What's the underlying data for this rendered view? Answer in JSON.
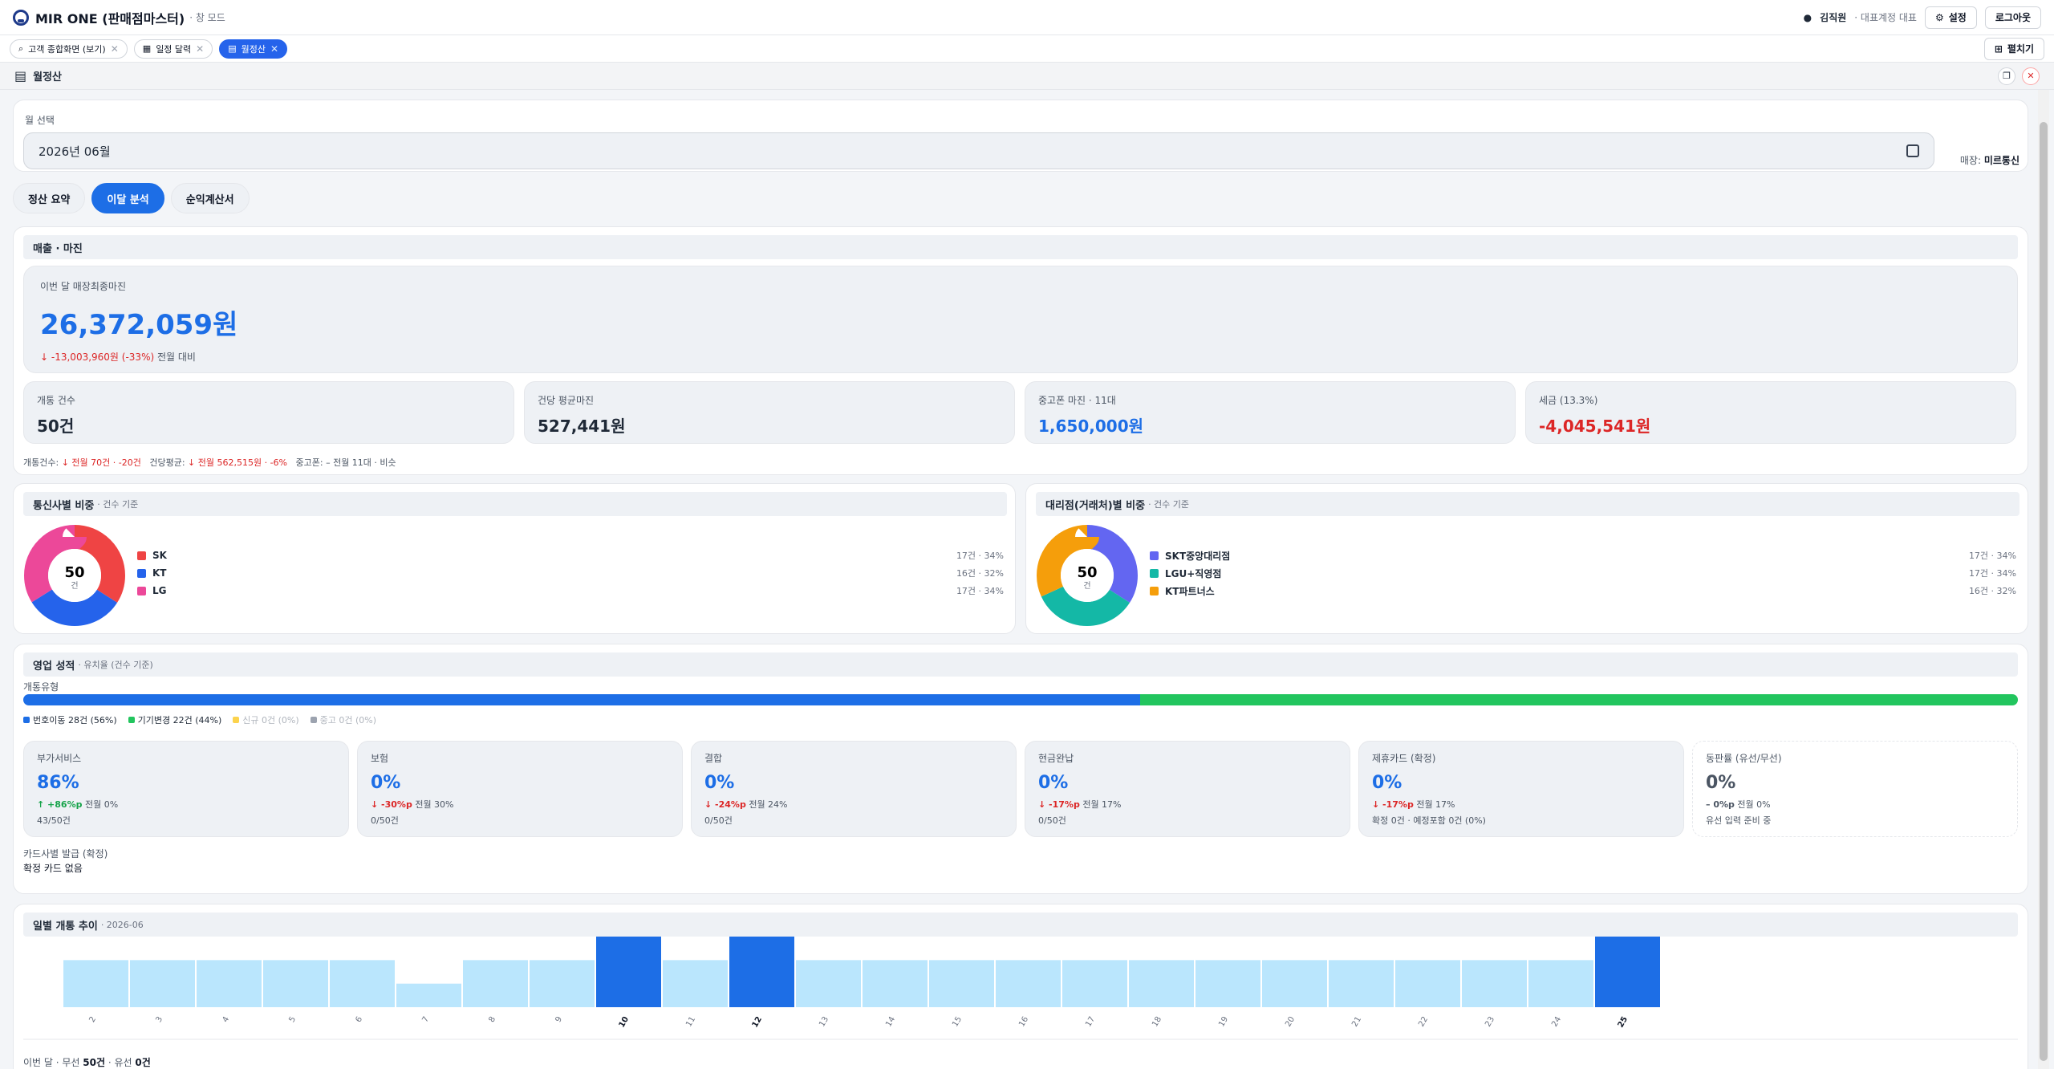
{
  "app": {
    "title": "MIR ONE (판매점마스터)",
    "mode": "· 창 모드"
  },
  "user": {
    "name": "김직원",
    "role": "· 대표계정 대표",
    "settings": "설정",
    "logout": "로그아웃"
  },
  "tabs": [
    {
      "label": "고객 종합화면 (보기)",
      "active": false
    },
    {
      "label": "일정 달력",
      "active": false
    },
    {
      "label": "월정산",
      "active": true
    }
  ],
  "tab_close": "✕",
  "layout_btn": "펼치기",
  "window": {
    "title": "월정산"
  },
  "month": {
    "label": "월 선택",
    "value": "2026년 06월",
    "store_label": "매장:",
    "store": "미르통신"
  },
  "views": [
    "정산 요약",
    "이달 분석",
    "순익계산서"
  ],
  "active_view": 1,
  "sales": {
    "title": "매출 · 마진",
    "hero_label": "이번 달 매장최종마진",
    "hero_value": "26,372,059원",
    "hero_arrow": "↓",
    "hero_delta": "-13,003,960원 (-33%)",
    "hero_delta_suffix": "전월 대비",
    "kpis": [
      {
        "label": "개통 건수",
        "value": "50건",
        "tone": "dark"
      },
      {
        "label": "건당 평균마진",
        "value": "527,441원",
        "tone": "dark"
      },
      {
        "label": "중고폰 마진 · 11대",
        "value": "1,650,000원",
        "tone": "blue"
      },
      {
        "label": "세금 (13.3%)",
        "value": "-4,045,541원",
        "tone": "red"
      }
    ],
    "compare": {
      "a_label": "개통건수:",
      "a_val": "↓ 전월 70건 · -20건",
      "b_label": "건당평균:",
      "b_val": "↓ 전월 562,515원 · -6%",
      "c_label": "중고폰:",
      "c_val": "– 전월 11대 · 비슷"
    }
  },
  "carrier": {
    "title": "통신사별 비중",
    "sub": "· 건수 기준",
    "total": "50",
    "unit": "건",
    "items": [
      {
        "name": "SK",
        "count": 17,
        "text": "17건 · 34%",
        "color": "#ef4444"
      },
      {
        "name": "KT",
        "count": 16,
        "text": "16건 · 32%",
        "color": "#2563eb"
      },
      {
        "name": "LG",
        "count": 17,
        "text": "17건 · 34%",
        "color": "#ec4899"
      }
    ]
  },
  "agency": {
    "title": "대리점(거래처)별 비중",
    "sub": "· 건수 기준",
    "total": "50",
    "unit": "건",
    "items": [
      {
        "name": "SKT중앙대리점",
        "count": 17,
        "text": "17건 · 34%",
        "color": "#6366f1"
      },
      {
        "name": "LGU+직영점",
        "count": 17,
        "text": "17건 · 34%",
        "color": "#14b8a6"
      },
      {
        "name": "KT파트너스",
        "count": 16,
        "text": "16건 · 32%",
        "color": "#f59e0b"
      }
    ]
  },
  "perf": {
    "title": "영업 성적",
    "sub": "· 유치율 (건수 기준)",
    "type_label": "개통유형",
    "type_segments": [
      {
        "label": "번호이동 28건 (56%)",
        "pct": 56,
        "color": "#1d6ee6",
        "muted": false
      },
      {
        "label": "기기변경 22건 (44%)",
        "pct": 44,
        "color": "#22c55e",
        "muted": false
      },
      {
        "label": "신규 0건 (0%)",
        "pct": 0,
        "color": "#fcd34d",
        "muted": true
      },
      {
        "label": "중고 0건 (0%)",
        "pct": 0,
        "color": "#9ca3af",
        "muted": true
      }
    ],
    "cards": [
      {
        "label": "부가서비스",
        "value": "86%",
        "delta": "↑ +86%p",
        "delta_tone": "green",
        "prev": "전월 0%",
        "sub": "43/50건",
        "tone": "blue"
      },
      {
        "label": "보험",
        "value": "0%",
        "delta": "↓ -30%p",
        "delta_tone": "red",
        "prev": "전월 30%",
        "sub": "0/50건",
        "tone": "blue"
      },
      {
        "label": "결합",
        "value": "0%",
        "delta": "↓ -24%p",
        "delta_tone": "red",
        "prev": "전월 24%",
        "sub": "0/50건",
        "tone": "blue"
      },
      {
        "label": "현금완납",
        "value": "0%",
        "delta": "↓ -17%p",
        "delta_tone": "red",
        "prev": "전월 17%",
        "sub": "0/50건",
        "tone": "blue"
      },
      {
        "label": "제휴카드 (확정)",
        "value": "0%",
        "delta": "↓ -17%p",
        "delta_tone": "red",
        "prev": "전월 17%",
        "sub": "확정 0건 · 예정포함 0건 (0%)",
        "tone": "blue"
      },
      {
        "label": "동판률 (유선/무선)",
        "value": "0%",
        "delta": "– 0%p",
        "delta_tone": "gray",
        "prev": "전월 0%",
        "sub": "유선 입력 준비 중",
        "tone": "gray"
      }
    ],
    "card_issue_label": "카드사별 발급 (확정)",
    "card_issue_value": "확정 카드 없음"
  },
  "daily": {
    "title": "일별 개통 추이",
    "sub": "· 2026-06",
    "footer_prefix": "이번 달 · 무선",
    "footer_wireless": "50건",
    "footer_mid": "· 유선",
    "footer_wired": "0건"
  },
  "chart_data": {
    "type": "bar",
    "categories": [
      "2",
      "3",
      "4",
      "5",
      "6",
      "7",
      "8",
      "9",
      "10",
      "11",
      "12",
      "13",
      "14",
      "15",
      "16",
      "17",
      "18",
      "19",
      "20",
      "21",
      "22",
      "23",
      "24",
      "25"
    ],
    "values": [
      2,
      2,
      2,
      2,
      2,
      1,
      2,
      2,
      3,
      2,
      3,
      2,
      2,
      2,
      2,
      2,
      2,
      2,
      2,
      2,
      2,
      2,
      2,
      3
    ],
    "highlight": [
      "10",
      "12",
      "25"
    ],
    "colors": {
      "normal": "#bae6fd",
      "highlight": "#1d6ee6"
    }
  },
  "colors": {
    "accent": "#1d6ee6",
    "danger": "#dc2626",
    "success": "#16a34a"
  }
}
